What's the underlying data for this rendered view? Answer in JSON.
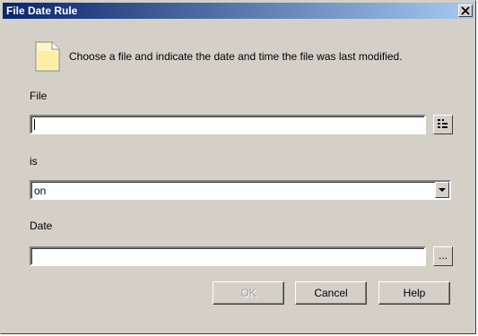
{
  "window": {
    "title": "File Date Rule",
    "close_glyph": "✕"
  },
  "prompt": "Choose a file and indicate the date and time the file was last modified.",
  "icons": {
    "document": "document-icon",
    "browse_file": "file-browse-icon"
  },
  "file": {
    "label": "File",
    "value": ""
  },
  "is": {
    "label": "is",
    "selected": "on"
  },
  "date": {
    "label": "Date",
    "value": "",
    "browse_label": "..."
  },
  "buttons": {
    "ok": "OK",
    "cancel": "Cancel",
    "help": "Help"
  }
}
